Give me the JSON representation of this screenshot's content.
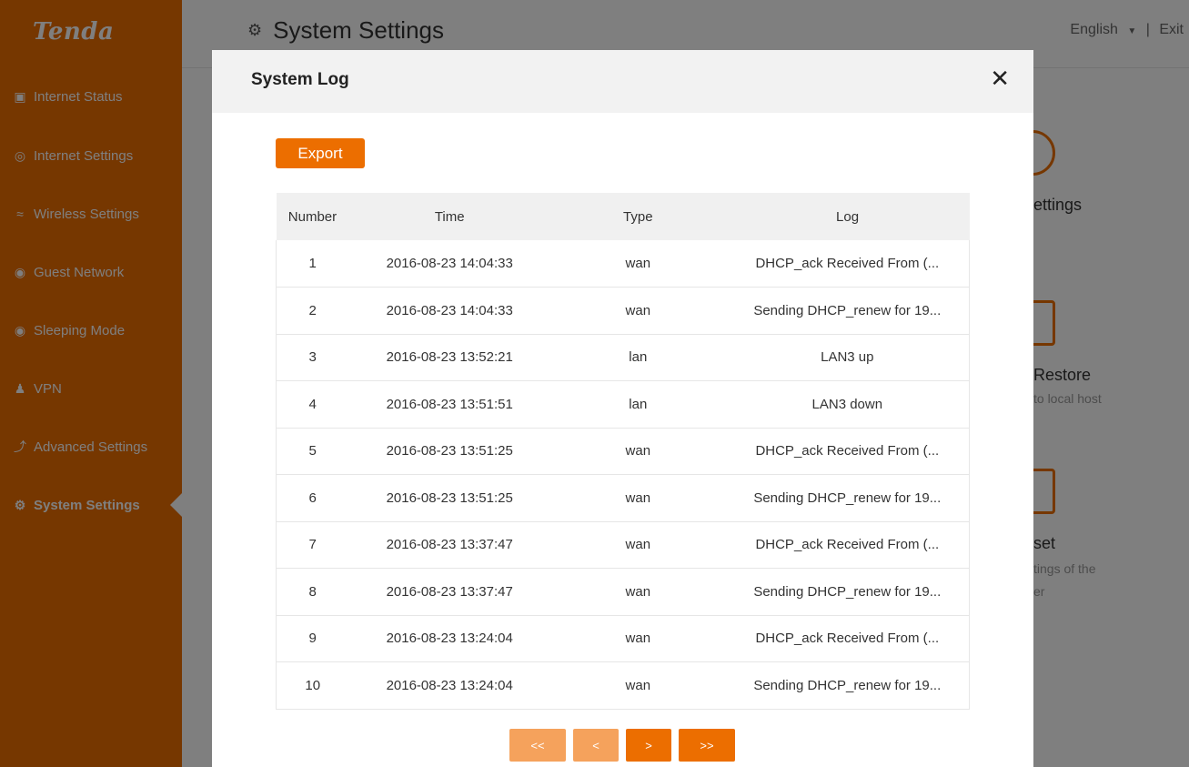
{
  "brand": "Tenda",
  "colors": {
    "accent": "#ec6e00",
    "sidebar": "#ec6e00",
    "disabled_btn": "#f5a25c"
  },
  "sidebar": {
    "items": [
      {
        "label": "Internet Status",
        "icon": "network-status-icon"
      },
      {
        "label": "Internet Settings",
        "icon": "globe-icon"
      },
      {
        "label": "Wireless Settings",
        "icon": "wifi-icon"
      },
      {
        "label": "Guest Network",
        "icon": "guest-icon"
      },
      {
        "label": "Sleeping Mode",
        "icon": "sleep-icon"
      },
      {
        "label": "VPN",
        "icon": "vpn-icon"
      },
      {
        "label": "Advanced Settings",
        "icon": "wrench-icon"
      },
      {
        "label": "System Settings",
        "icon": "gear-icon",
        "active": true
      }
    ]
  },
  "header": {
    "title": "System Settings",
    "language": "English",
    "separator": "|",
    "exit": "Exit"
  },
  "background": {
    "card1_title": "ettings",
    "card2_title": "Restore",
    "card2_sub": "to local host",
    "card3_title": "set",
    "card3_sub1": "tings of the",
    "card3_sub2": "er"
  },
  "modal": {
    "title": "System Log",
    "close": "✕",
    "export_label": "Export",
    "columns": [
      "Number",
      "Time",
      "Type",
      "Log"
    ],
    "rows": [
      {
        "number": "1",
        "time": "2016-08-23 14:04:33",
        "type": "wan",
        "log": "DHCP_ack Received From (..."
      },
      {
        "number": "2",
        "time": "2016-08-23 14:04:33",
        "type": "wan",
        "log": "Sending DHCP_renew for 19..."
      },
      {
        "number": "3",
        "time": "2016-08-23 13:52:21",
        "type": "lan",
        "log": "LAN3 up"
      },
      {
        "number": "4",
        "time": "2016-08-23 13:51:51",
        "type": "lan",
        "log": "LAN3 down"
      },
      {
        "number": "5",
        "time": "2016-08-23 13:51:25",
        "type": "wan",
        "log": "DHCP_ack Received From (..."
      },
      {
        "number": "6",
        "time": "2016-08-23 13:51:25",
        "type": "wan",
        "log": "Sending DHCP_renew for 19..."
      },
      {
        "number": "7",
        "time": "2016-08-23 13:37:47",
        "type": "wan",
        "log": "DHCP_ack Received From (..."
      },
      {
        "number": "8",
        "time": "2016-08-23 13:37:47",
        "type": "wan",
        "log": "Sending DHCP_renew for 19..."
      },
      {
        "number": "9",
        "time": "2016-08-23 13:24:04",
        "type": "wan",
        "log": "DHCP_ack Received From (..."
      },
      {
        "number": "10",
        "time": "2016-08-23 13:24:04",
        "type": "wan",
        "log": "Sending DHCP_renew for 19..."
      }
    ],
    "pager": {
      "first": "<<",
      "prev": "<",
      "next": ">",
      "last": ">>"
    }
  }
}
